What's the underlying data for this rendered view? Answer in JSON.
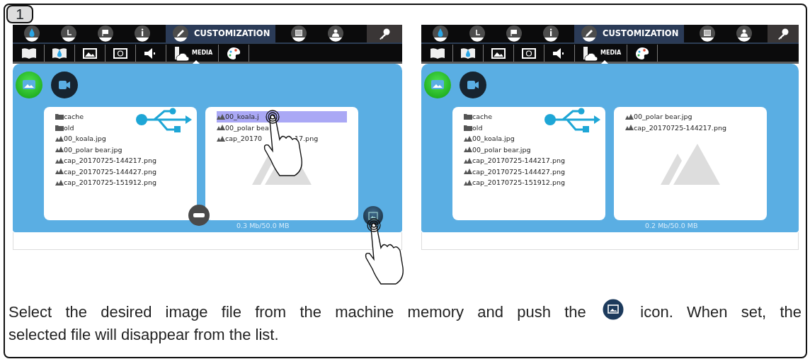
{
  "step": "1",
  "screens": [
    {
      "top_tabs": [
        {
          "kind": "drop",
          "selected": false
        },
        {
          "kind": "clock",
          "selected": false
        },
        {
          "kind": "flag",
          "selected": false
        },
        {
          "kind": "info",
          "selected": false
        },
        {
          "kind": "pencil",
          "label": "CUSTOMIZATION",
          "selected": true
        },
        {
          "kind": "panel",
          "selected": false
        },
        {
          "kind": "person",
          "selected": false
        }
      ],
      "sub_tabs": [
        {
          "kind": "book",
          "selected": false
        },
        {
          "kind": "book-drop",
          "selected": false
        },
        {
          "kind": "image",
          "selected": false
        },
        {
          "kind": "screen",
          "selected": false
        },
        {
          "kind": "speaker",
          "selected": false
        },
        {
          "kind": "media",
          "label": "MEDIA",
          "selected": true
        },
        {
          "kind": "palette",
          "selected": false
        }
      ],
      "modes": [
        {
          "kind": "image",
          "selected": true
        },
        {
          "kind": "video",
          "selected": false
        }
      ],
      "usb_files": [
        {
          "kind": "folder",
          "text": "cache"
        },
        {
          "kind": "folder",
          "text": "old"
        },
        {
          "kind": "image",
          "text": "00_koala.jpg"
        },
        {
          "kind": "image",
          "text": "00_polar bear.jpg"
        },
        {
          "kind": "image",
          "text": "cap_20170725-144217.png"
        },
        {
          "kind": "image",
          "text": "cap_20170725-144427.png"
        },
        {
          "kind": "image",
          "text": "cap_20170725-151912.png"
        }
      ],
      "machine_files": [
        {
          "text": "00_koala.j",
          "selected": true
        },
        {
          "text": "00_polar bea",
          "selected": false
        },
        {
          "text": "cap_20170",
          "text_after": "17.png",
          "selected": false
        }
      ],
      "storage": "0.3 Mb/50.0 MB",
      "remove_button": true,
      "set_button": true,
      "touch_hints": true
    },
    {
      "top_tabs": [
        {
          "kind": "drop",
          "selected": false
        },
        {
          "kind": "clock",
          "selected": false
        },
        {
          "kind": "flag",
          "selected": false
        },
        {
          "kind": "info",
          "selected": false
        },
        {
          "kind": "pencil",
          "label": "CUSTOMIZATION",
          "selected": true
        },
        {
          "kind": "panel",
          "selected": false
        },
        {
          "kind": "person",
          "selected": false
        }
      ],
      "sub_tabs": [
        {
          "kind": "book",
          "selected": false
        },
        {
          "kind": "book-drop",
          "selected": false
        },
        {
          "kind": "image",
          "selected": false
        },
        {
          "kind": "screen",
          "selected": false
        },
        {
          "kind": "speaker",
          "selected": false
        },
        {
          "kind": "media",
          "label": "MEDIA",
          "selected": true
        },
        {
          "kind": "palette",
          "selected": false
        }
      ],
      "modes": [
        {
          "kind": "image",
          "selected": true
        },
        {
          "kind": "video",
          "selected": false
        }
      ],
      "usb_files": [
        {
          "kind": "folder",
          "text": "cache"
        },
        {
          "kind": "folder",
          "text": "old"
        },
        {
          "kind": "image",
          "text": "00_koala.jpg"
        },
        {
          "kind": "image",
          "text": "00_polar bear.jpg"
        },
        {
          "kind": "image",
          "text": "cap_20170725-144217.png"
        },
        {
          "kind": "image",
          "text": "cap_20170725-144427.png"
        },
        {
          "kind": "image",
          "text": "cap_20170725-151912.png"
        }
      ],
      "machine_files": [
        {
          "text": "00_polar bear.jpg",
          "selected": false
        },
        {
          "text": "cap_20170725-144217.png",
          "selected": false
        }
      ],
      "storage": "0.2 Mb/50.0 MB"
    }
  ],
  "caption": {
    "before": "Select the desired image file from the machine memory and push the",
    "after": "icon. When set, the",
    "line2": "selected file will disappear from the list."
  }
}
